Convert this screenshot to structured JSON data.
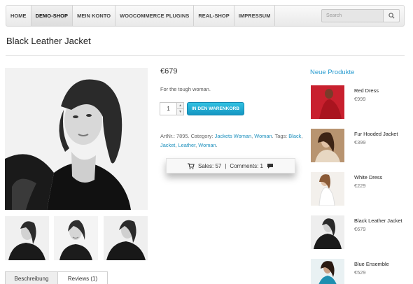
{
  "nav": {
    "items": [
      {
        "label": "HOME",
        "active": false
      },
      {
        "label": "DEMO-SHOP",
        "active": true
      },
      {
        "label": "MEIN KONTO",
        "active": false
      },
      {
        "label": "WOOCOMMERCE PLUGINS",
        "active": false
      },
      {
        "label": "REAL-SHOP",
        "active": false
      },
      {
        "label": "IMPRESSUM",
        "active": false
      }
    ],
    "search_placeholder": "Search",
    "search_icon": "magnifier-icon"
  },
  "product": {
    "title": "Black Leather Jacket",
    "price": "€679",
    "short_description": "For the tough woman.",
    "quantity": "1",
    "add_to_cart_label": "IN DEN WARENKORB",
    "meta": {
      "artnr_label": "ArtNr.: 7895.",
      "category_label": "Category:",
      "categories": [
        "Jackets Woman",
        "Woman"
      ],
      "tags_label": "Tags:",
      "tags": [
        "Black",
        "Jacket",
        "Leather",
        "Woman"
      ]
    },
    "sales_label": "Sales: 57",
    "separator": "|",
    "comments_label": "Comments: 1"
  },
  "tabs": [
    {
      "label": "Beschreibung",
      "active": false
    },
    {
      "label": "Reviews (1)",
      "active": true
    }
  ],
  "sidebar": {
    "title": "Neue Produkte",
    "products": [
      {
        "name": "Red Dress",
        "price": "€999",
        "swatch": "#c8202e"
      },
      {
        "name": "Fur Hooded Jacket",
        "price": "€399",
        "swatch": "#c9a27a"
      },
      {
        "name": "White Dress",
        "price": "€229",
        "swatch": "#e9e2dc"
      },
      {
        "name": "Black Leather Jacket",
        "price": "€679",
        "swatch": "#222222"
      },
      {
        "name": "Blue Ensemble",
        "price": "€529",
        "swatch": "#1f8fb0"
      }
    ]
  },
  "colors": {
    "accent": "#2a9cd0",
    "link": "#1b8fbd",
    "button": "#1ca9d3"
  }
}
